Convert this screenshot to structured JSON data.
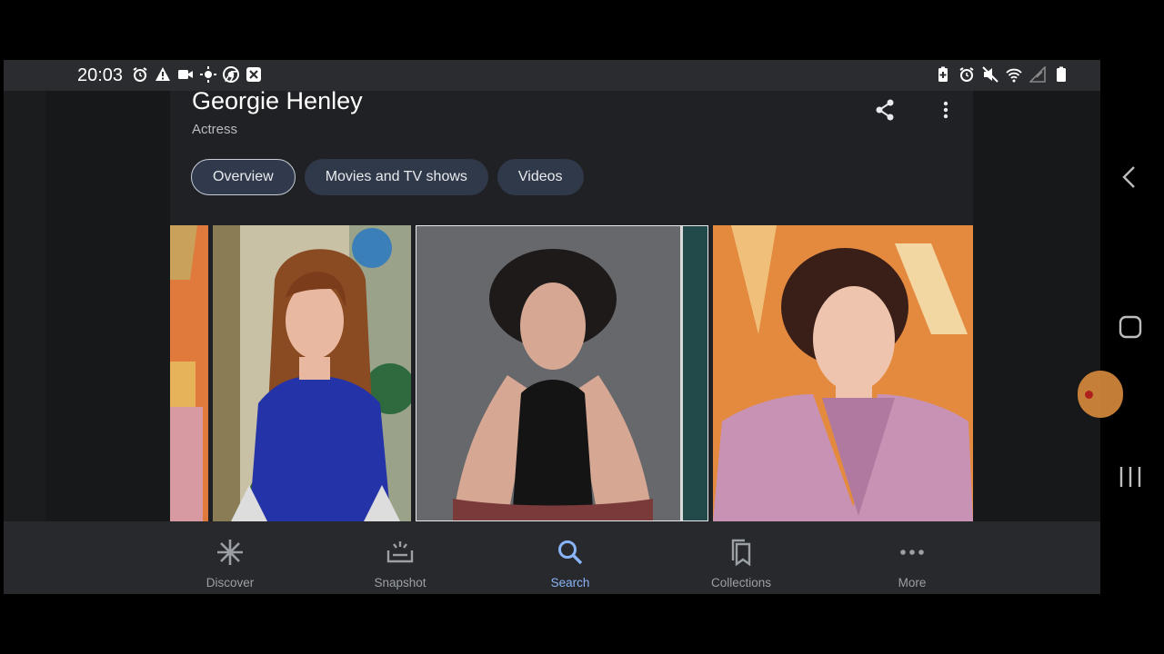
{
  "status_bar": {
    "time": "20:03",
    "left_icons": [
      "alarm-icon",
      "warning-icon",
      "video-camera-icon",
      "brightness-icon",
      "chrome-icon",
      "x-icon"
    ],
    "right_icons": [
      "battery-saver-icon",
      "alarm-icon",
      "mute-icon",
      "wifi-icon",
      "no-signal-icon",
      "battery-icon"
    ]
  },
  "header": {
    "title": "Georgie Henley",
    "subtitle": "Actress",
    "share_icon": "share-icon",
    "menu_icon": "more-vert-icon"
  },
  "tabs": [
    {
      "label": "Overview",
      "active": true
    },
    {
      "label": "Movies and TV shows",
      "active": false
    },
    {
      "label": "Videos",
      "active": false
    }
  ],
  "gallery": {
    "photos": [
      "photo-partial-left",
      "photo-blue-dress",
      "photo-black-top",
      "photo-pink-blazer"
    ]
  },
  "bottom_nav": [
    {
      "label": "Discover",
      "icon": "asterisk-icon",
      "active": false
    },
    {
      "label": "Snapshot",
      "icon": "snapshot-icon",
      "active": false
    },
    {
      "label": "Search",
      "icon": "search-icon",
      "active": true
    },
    {
      "label": "Collections",
      "icon": "bookmarks-icon",
      "active": false
    },
    {
      "label": "More",
      "icon": "more-horiz-icon",
      "active": false
    }
  ],
  "colors": {
    "accent": "#8ab4f8",
    "background": "#202124",
    "nav_bar": "#28292c",
    "tab_fill": "#30394a"
  }
}
